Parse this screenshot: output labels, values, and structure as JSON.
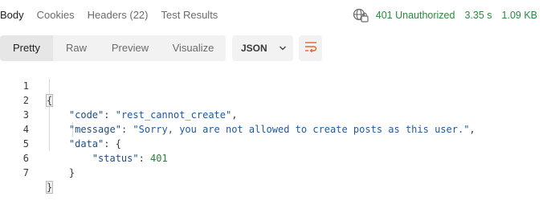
{
  "tabs": [
    {
      "label": "Body",
      "active": true
    },
    {
      "label": "Cookies",
      "active": false
    },
    {
      "label": "Headers",
      "count": "(22)",
      "active": false
    },
    {
      "label": "Test Results",
      "active": false
    }
  ],
  "status": {
    "code_text": "401 Unauthorized",
    "time": "3.35 s",
    "size": "1.09 KB",
    "color": "#2b8a3e"
  },
  "view_modes": [
    "Pretty",
    "Raw",
    "Preview",
    "Visualize"
  ],
  "active_view_mode": "Pretty",
  "format_dropdown": {
    "value": "JSON"
  },
  "icons": {
    "network": "globe-icon",
    "dropdown": "chevron-down-icon",
    "wrap": "wrap-lines-icon"
  },
  "accent_color": "#e8642c",
  "body": {
    "line_numbers": [
      "1",
      "2",
      "3",
      "4",
      "5",
      "6",
      "7"
    ],
    "open_brace": "{",
    "close_brace": "}",
    "code_key": "\"code\"",
    "code_value": "\"rest_cannot_create\"",
    "message_key": "\"message\"",
    "message_value": "\"Sorry, you are not allowed to create posts as this user.\"",
    "data_key": "\"data\"",
    "data_open": "{",
    "status_key": "\"status\"",
    "status_value": "401",
    "data_close": "}"
  }
}
